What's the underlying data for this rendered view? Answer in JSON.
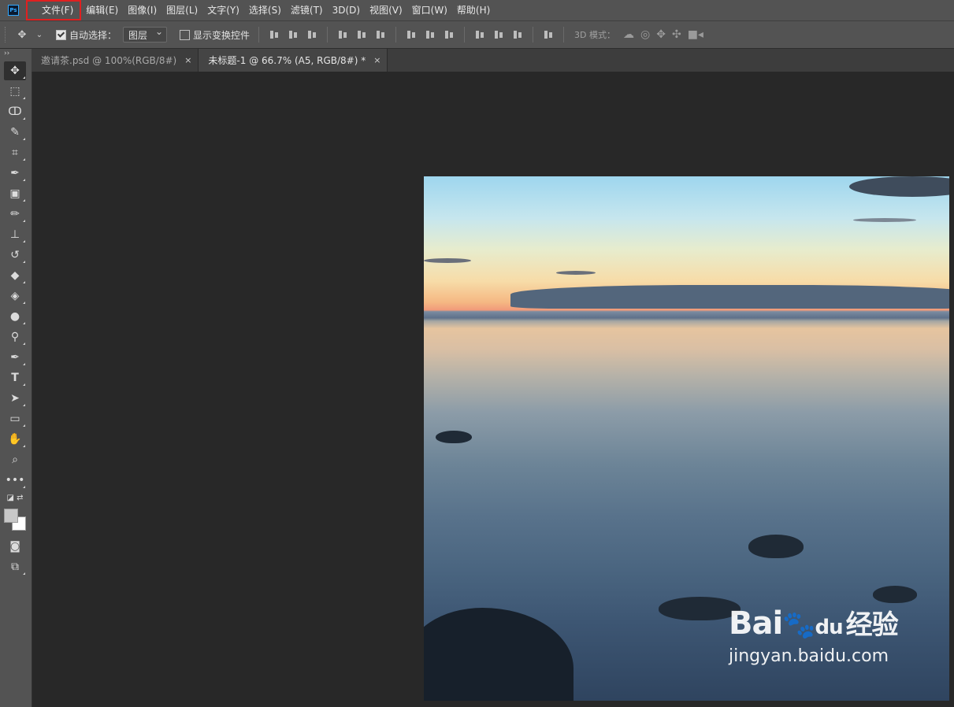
{
  "app": {
    "logo_text": "Ps"
  },
  "menu": {
    "items": [
      "文件(F)",
      "编辑(E)",
      "图像(I)",
      "图层(L)",
      "文字(Y)",
      "选择(S)",
      "滤镜(T)",
      "3D(D)",
      "视图(V)",
      "窗口(W)",
      "帮助(H)"
    ],
    "highlighted": "文件(F)",
    "highlight_color": "#e02020"
  },
  "options": {
    "auto_select_label": "自动选择：",
    "auto_select_checked": true,
    "auto_select_target": "图层",
    "show_transform_label": "显示变换控件",
    "show_transform_checked": false,
    "mode_3d_label": "3D 模式："
  },
  "tabs": [
    {
      "title": "邀请茶.psd @ 100%(RGB/8#)",
      "close": "×",
      "active": false
    },
    {
      "title": "未标题-1 @ 66.7% (A5, RGB/8#) *",
      "close": "×",
      "active": true
    }
  ],
  "toolbar": {
    "expand": "››",
    "tools": [
      "move-tool",
      "marquee-tool",
      "lasso-tool",
      "quick-select-tool",
      "crop-tool",
      "eyedropper-tool",
      "healing-tool",
      "brush-tool",
      "clone-stamp-tool",
      "history-brush-tool",
      "eraser-tool",
      "paint-bucket-tool",
      "blur-tool",
      "dodge-tool",
      "pen-tool",
      "type-tool",
      "path-select-tool",
      "rectangle-tool",
      "hand-tool",
      "zoom-tool",
      "more-tools"
    ],
    "foreground_color": "#c8c8c8",
    "background_color": "#ffffff"
  },
  "watermark": {
    "brand": "Bai",
    "brand_suffix": "du",
    "brand_cn": "经验",
    "url": "jingyan.baidu.com"
  }
}
